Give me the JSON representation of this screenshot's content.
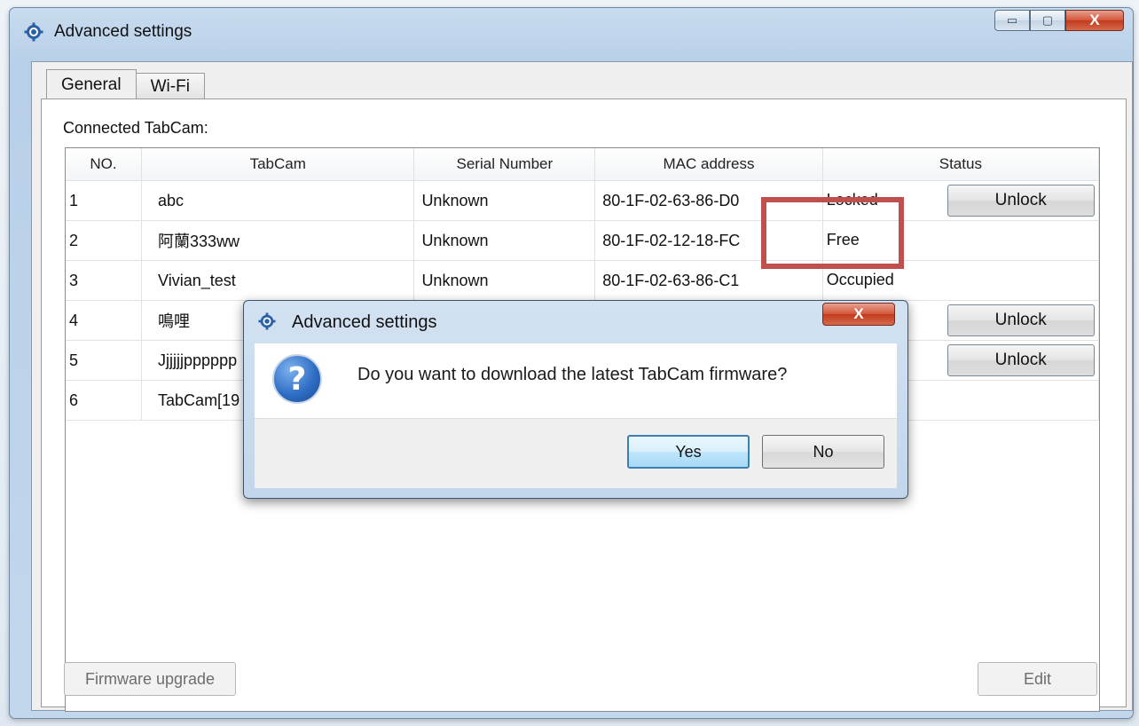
{
  "window": {
    "title": "Advanced settings",
    "minimize_glyph": "▭",
    "maximize_glyph": "▢",
    "close_glyph": "X"
  },
  "tabs": [
    {
      "label": "General",
      "selected": true
    },
    {
      "label": "Wi-Fi",
      "selected": false
    }
  ],
  "connected_label": "Connected TabCam:",
  "table": {
    "headers": [
      "NO.",
      "TabCam",
      "Serial Number",
      "MAC address",
      "Status"
    ],
    "rows": [
      {
        "no": "1",
        "tabcam": "abc",
        "serial": "Unknown",
        "mac": "80-1F-02-63-86-D0",
        "status": "Locked",
        "button": "Unlock"
      },
      {
        "no": "2",
        "tabcam": "阿蘭333ww",
        "serial": "Unknown",
        "mac": "80-1F-02-12-18-FC",
        "status": "Free",
        "button": ""
      },
      {
        "no": "3",
        "tabcam": "Vivian_test",
        "serial": "Unknown",
        "mac": "80-1F-02-63-86-C1",
        "status": "Occupied",
        "button": ""
      },
      {
        "no": "4",
        "tabcam": "鳴哩",
        "serial": "",
        "mac": "",
        "status": "",
        "button": "Unlock"
      },
      {
        "no": "5",
        "tabcam": "Jjjjjjpppppp",
        "serial": "",
        "mac": "",
        "status": "",
        "button": "Unlock"
      },
      {
        "no": "6",
        "tabcam": "TabCam[19",
        "serial": "",
        "mac": "",
        "status": "",
        "button": ""
      }
    ]
  },
  "bottom": {
    "firmware_upgrade": "Firmware upgrade",
    "edit": "Edit"
  },
  "dialog": {
    "title": "Advanced settings",
    "close_glyph": "X",
    "icon_glyph": "?",
    "message": "Do you want to download the latest TabCam firmware?",
    "yes": "Yes",
    "no": "No"
  },
  "colors": {
    "highlight": "#c0504d",
    "titlebar": "#c9dcef"
  }
}
